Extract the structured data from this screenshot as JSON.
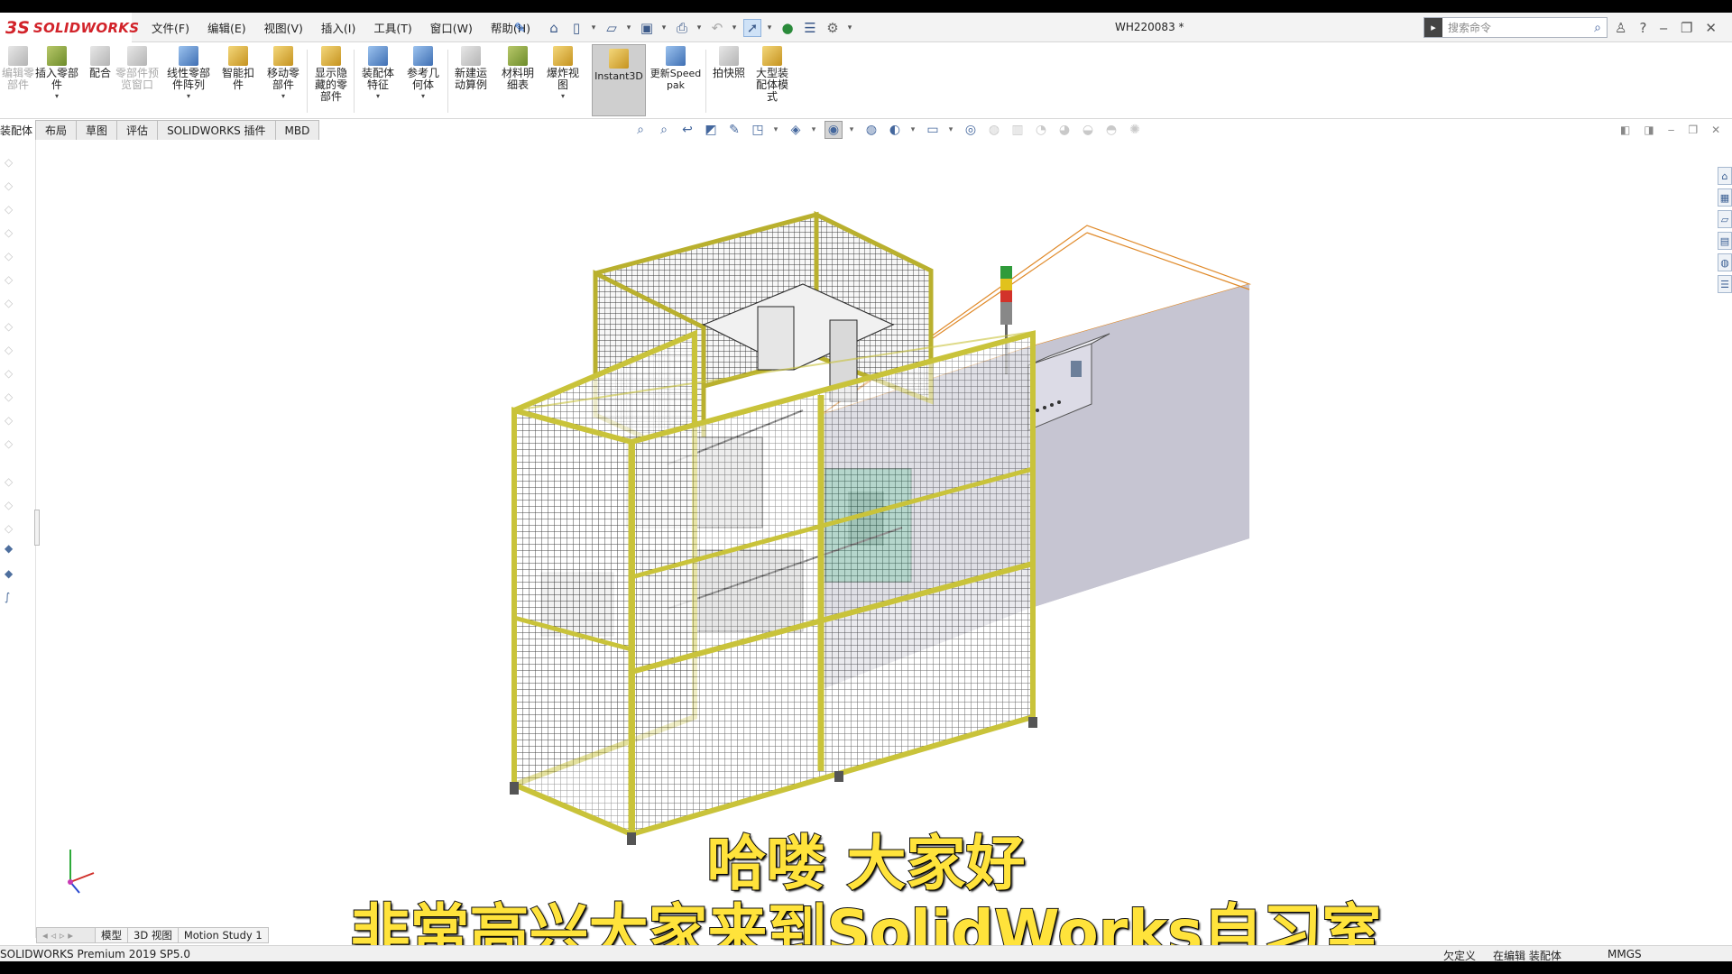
{
  "app": {
    "logo_prefix": "3S",
    "logo_text": "SOLIDWORKS",
    "document_title": "WH220083 *"
  },
  "menu": [
    "文件(F)",
    "编辑(E)",
    "视图(V)",
    "插入(I)",
    "工具(T)",
    "窗口(W)",
    "帮助(H)"
  ],
  "search": {
    "placeholder": "搜索命令"
  },
  "ribbon": {
    "items": [
      {
        "label": "编辑零部件",
        "enabled": false
      },
      {
        "label": "插入零部件",
        "enabled": true
      },
      {
        "label": "配合",
        "enabled": true
      },
      {
        "label": "零部件预览窗口",
        "enabled": false
      },
      {
        "label": "线性零部件阵列",
        "enabled": true
      },
      {
        "label": "智能扣件",
        "enabled": true
      },
      {
        "label": "移动零部件",
        "enabled": true
      },
      {
        "label": "显示隐藏的零部件",
        "enabled": true
      },
      {
        "label": "装配体特征",
        "enabled": true
      },
      {
        "label": "参考几何体",
        "enabled": true
      },
      {
        "label": "新建运动算例",
        "enabled": true
      },
      {
        "label": "材料明细表",
        "enabled": true
      },
      {
        "label": "爆炸视图",
        "enabled": true
      },
      {
        "label": "Instant3D",
        "enabled": true,
        "active": true
      },
      {
        "label": "更新Speedpak",
        "enabled": true
      },
      {
        "label": "拍快照",
        "enabled": true
      },
      {
        "label": "大型装配体模式",
        "enabled": true
      }
    ]
  },
  "tabs": [
    "装配体",
    "布局",
    "草图",
    "评估",
    "SOLIDWORKS 插件",
    "MBD"
  ],
  "model_tabs": [
    "模型",
    "3D 视图",
    "Motion Study 1"
  ],
  "status": {
    "version": "SOLIDWORKS Premium 2019 SP5.0",
    "definition": "欠定义",
    "editing": "在编辑 装配体",
    "units": "MMGS"
  },
  "subtitles": {
    "line1": "哈喽 大家好",
    "line2": "非常高兴大家来到SolidWorks自习室"
  },
  "colors": {
    "brand_red": "#d2232a",
    "frame_yellow": "#c9c33a",
    "subtitle_yellow": "#ffe33b",
    "selected_edge_orange": "#e08a2a"
  }
}
